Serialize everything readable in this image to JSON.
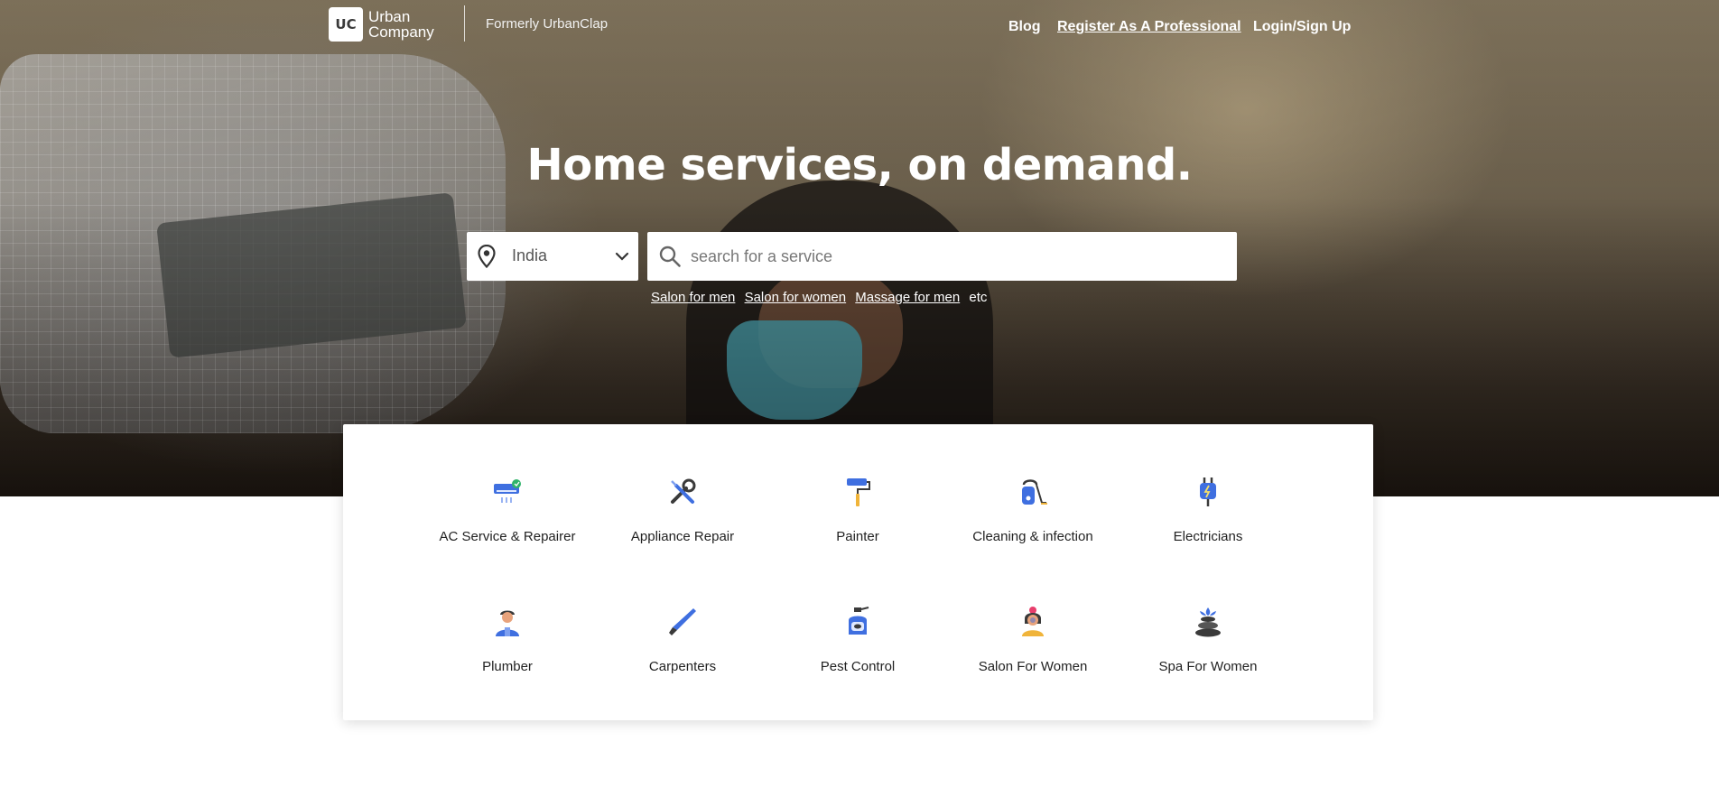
{
  "brand": {
    "logo_mark": "UC",
    "logo_line1": "Urban",
    "logo_line2": "Company",
    "formerly": "Formerly UrbanClap"
  },
  "nav": {
    "blog": "Blog",
    "register": "Register As A Professional",
    "login": "Login/Sign Up"
  },
  "hero": {
    "title": "Home services, on demand."
  },
  "location": {
    "value": "India",
    "icon": "map-pin-icon"
  },
  "search": {
    "placeholder": "search for a service",
    "icon": "search-icon"
  },
  "suggestions": {
    "items": [
      "Salon for men",
      "Salon for women",
      "Massage for men"
    ],
    "suffix": "etc"
  },
  "categories": [
    {
      "label": "AC Service & Repairer",
      "icon": "ac-unit-icon"
    },
    {
      "label": "Appliance Repair",
      "icon": "wrench-screwdriver-icon"
    },
    {
      "label": "Painter",
      "icon": "paint-roller-icon"
    },
    {
      "label": "Cleaning & infection",
      "icon": "vacuum-cleaner-icon"
    },
    {
      "label": "Electricians",
      "icon": "electric-plug-icon"
    },
    {
      "label": "Plumber",
      "icon": "plumber-person-icon"
    },
    {
      "label": "Carpenters",
      "icon": "hand-saw-icon"
    },
    {
      "label": "Pest Control",
      "icon": "pest-spray-icon"
    },
    {
      "label": "Salon For Women",
      "icon": "woman-face-icon"
    },
    {
      "label": "Spa For Women",
      "icon": "spa-stones-icon"
    }
  ],
  "colors": {
    "icon_blue": "#3f6fe0",
    "icon_dark": "#3a3a3a",
    "accent_green": "#2fb36a"
  }
}
